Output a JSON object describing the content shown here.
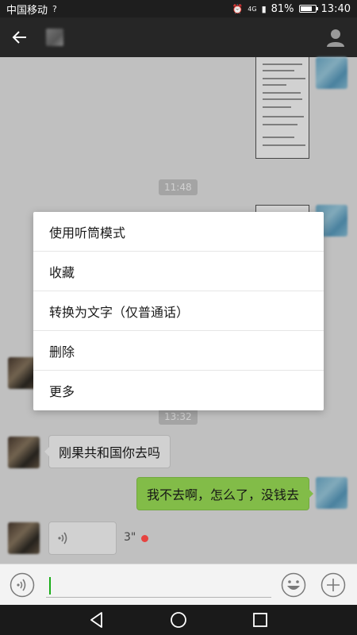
{
  "status_bar": {
    "carrier": "中国移动",
    "network": "4G",
    "battery_percent": "81%",
    "battery_level": 0.81,
    "time": "13:40"
  },
  "header": {
    "back_icon": "arrow-left-icon",
    "profile_icon": "person-icon"
  },
  "chat": {
    "timestamps": [
      "11:48",
      "13:32"
    ],
    "messages": [
      {
        "side": "left",
        "text": "刚果共和国你去吗"
      },
      {
        "side": "right",
        "text": "我不去啊，怎么了，没钱去"
      },
      {
        "side": "left",
        "type": "voice",
        "duration": "3\""
      }
    ]
  },
  "context_menu": {
    "items": [
      {
        "label": "使用听筒模式"
      },
      {
        "label": "收藏"
      },
      {
        "label": "转换为文字（仅普通话）"
      },
      {
        "label": "删除"
      },
      {
        "label": "更多"
      }
    ]
  },
  "input_bar": {
    "voice_icon": "voice-input-icon",
    "emoji_icon": "emoji-icon",
    "plus_icon": "plus-icon",
    "value": ""
  },
  "nav_bar": {
    "icons": [
      "back-triangle-icon",
      "home-circle-icon",
      "recents-square-icon"
    ]
  },
  "colors": {
    "sent_bubble": "#9fe658",
    "unread_dot": "#e64340",
    "header": "#262626",
    "cursor": "#1aad19"
  }
}
